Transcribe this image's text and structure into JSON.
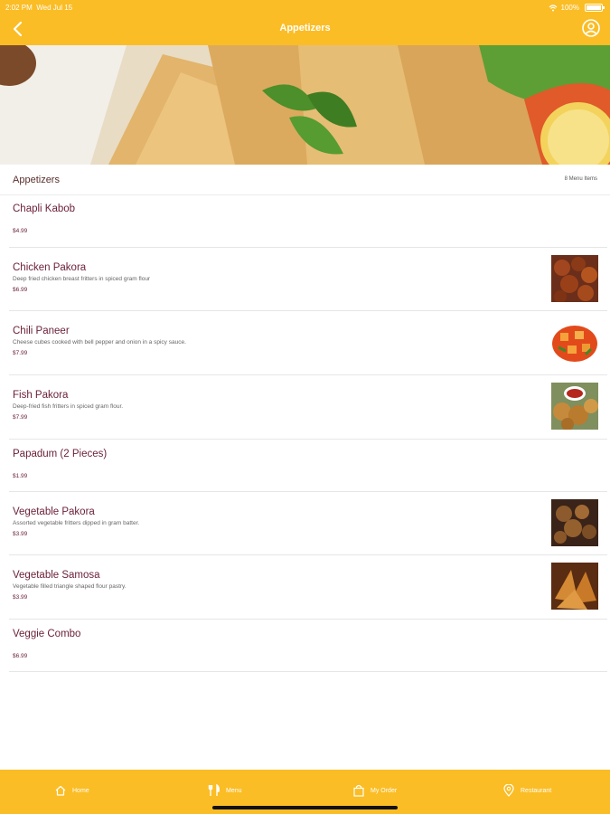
{
  "status_bar": {
    "time": "2:02 PM",
    "date": "Wed Jul 15",
    "battery": "100%"
  },
  "header": {
    "title": "Appetizers"
  },
  "section": {
    "title": "Appetizers",
    "count": "8 Menu Items"
  },
  "menu_items": [
    {
      "name": "Chapli Kabob",
      "description": "",
      "price": "$4.99"
    },
    {
      "name": "Chicken Pakora",
      "description": "Deep fried chicken breast fritters in spiced gram flour",
      "price": "$6.99",
      "image": "chicken-pakora"
    },
    {
      "name": "Chili Paneer",
      "description": "Cheese cubes cooked with bell pepper and onion in a spicy sauce.",
      "price": "$7.99",
      "image": "chili-paneer"
    },
    {
      "name": "Fish Pakora",
      "description": "Deep-fried fish fritters in spiced gram flour.",
      "price": "$7.99",
      "image": "fish-pakora"
    },
    {
      "name": "Papadum (2 Pieces)",
      "description": "",
      "price": "$1.99"
    },
    {
      "name": "Vegetable Pakora",
      "description": "Assorted vegetable fritters dipped in gram batter.",
      "price": "$3.99",
      "image": "vegetable-pakora"
    },
    {
      "name": "Vegetable Samosa",
      "description": "Vegetable filled triangle shaped flour pastry.",
      "price": "$3.99",
      "image": "vegetable-samosa"
    },
    {
      "name": "Veggie Combo",
      "description": "",
      "price": "$6.99"
    }
  ],
  "tabs": [
    {
      "label": "Home",
      "icon": "home-icon"
    },
    {
      "label": "Menu",
      "icon": "utensils-icon"
    },
    {
      "label": "My Order",
      "icon": "shopping-bag-icon"
    },
    {
      "label": "Restaurant",
      "icon": "location-pin-icon"
    }
  ],
  "colors": {
    "brand": "#fbbd25",
    "item_text": "#6a1f36"
  }
}
